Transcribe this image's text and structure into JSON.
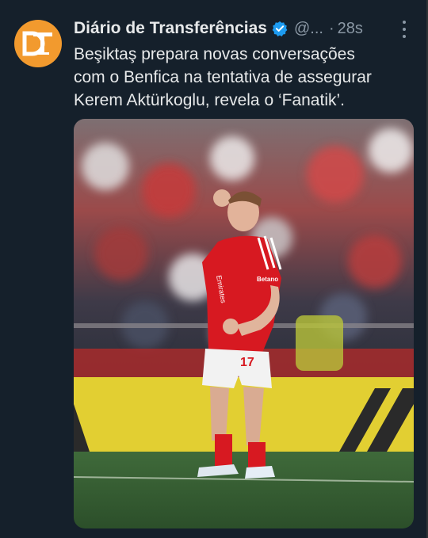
{
  "tweet": {
    "account_name": "Diário de Transferências",
    "handle": "@...",
    "separator": "·",
    "time": "28s",
    "avatar_letters": "DT",
    "verified_color": "#1d9bf0",
    "text_lines": [
      "Beşiktaş prepara novas conversações",
      "com o Benfica na tentativa de assegurar",
      "Kerem Aktürkoglu, revela o ‘Fanatik’."
    ],
    "media": {
      "jersey_number": "17",
      "sponsor_text": "Emirates",
      "sponsor_text_2": "Betano"
    }
  },
  "colors": {
    "background": "#15202b",
    "text": "#e7e9ea",
    "secondary": "#8b98a5",
    "avatar": "#f29a2e",
    "jersey_red": "#d71921"
  }
}
